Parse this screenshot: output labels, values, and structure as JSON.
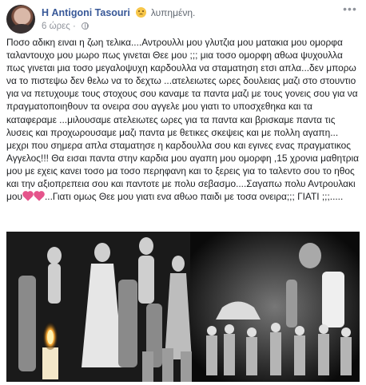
{
  "post": {
    "author_prefix": "Η",
    "author_name": "Antigoni Tasouri",
    "emoji_icon": "sad-face-emoji",
    "feeling": "λυπημένη.",
    "time": "6 ώρες",
    "privacy_icon": "globe-icon",
    "more_icon": "ellipsis-icon",
    "body_text_part1": "Ποσο αδικη ειναι η ζωη τελικα....Αντρουλλι μου γλυτζια μου ματακια μου ομορφα ταλαντουχο μου μωρο πως γινεται Θεε μου ;;; μια τοσο ομορφη αθωα ψυχουλλα πως γινεται μια τοσο μεγαλοψυχη καρδουλλα να σταματηση ετσι απλα...δεν μπορω να το πιστεψω δεν θελω να το δεχτω ...ατελειωτες ωρες δουλειας μαζι στο στουντιο για να πετυχουμε τους στοχους σου καναμε τα παντα μαζι με τους γονεις σου για να πραγματοποιηθουν τα ονειρα σου αγγελε μου γιατι το υποσχεθηκα και τα καταφεραμε ...μιλουσαμε ατελειωτες ωρες για τα παντα και βρισκαμε παντα τις λυσεις και προχωρουσαμε μαζι παντα με θετικες σκεψεις και με πολλη αγαπη... μεχρι που σημερα απλα σταματησε η καρδουλλα σου και εγινες ενας πραγματικος Αγγελος!!! Θα εισαι παντα στην καρδια μου αγαπη μου ομορφη ,15 χρονια μαθητρια μου με εχεις κανει τοσο μα τοσο περηφανη και το ξερεις για το ταλεντο σου το ηθος και την αξιοπρεπεια σου και παντοτε με πολυ σεβασμο....Σαγαπω πολυ Αντρουλακι μου",
    "body_text_part2": "...Γιατι ομως Θεε μου γιατι ενα αθωο παιδι με τοσα ονειρα;;; ΓΙΑΤΙ ;;;.....",
    "heart_icon": "pink-heart-icon",
    "photo_icon": "dance-collage-photo"
  }
}
